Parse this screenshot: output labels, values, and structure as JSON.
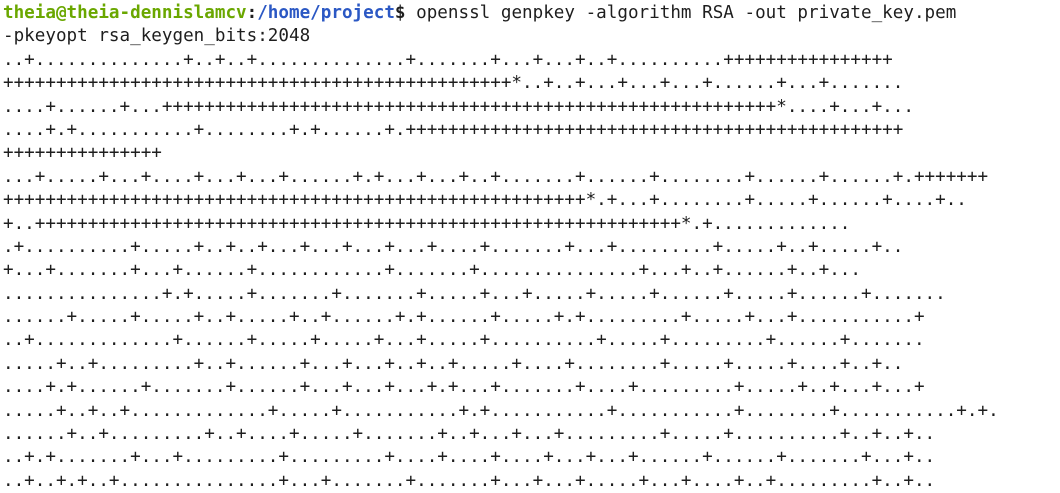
{
  "terminal": {
    "prompt": {
      "user_host": "theia@theia-dennislamcv",
      "separator": ":",
      "path": "/home/project",
      "symbol": "$"
    },
    "command": " openssl genpkey -algorithm RSA -out private_key.pem",
    "command_wrap": "-pkeyopt rsa_keygen_bits:2048",
    "output_lines": [
      "..+..............+..+..+..............+.......+...+...+..+..........++++++++++++++++",
      "++++++++++++++++++++++++++++++++++++++++++++++++*..+..+...+...+...+......+...+.......",
      "....+......+...++++++++++++++++++++++++++++++++++++++++++++++++++++++++++*....+...+...",
      "....+.+...........+........+.+......+.+++++++++++++++++++++++++++++++++++++++++++++++",
      "+++++++++++++++",
      "...+.....+...+....+...+...+......+.+...+...+..+.......+......+........+......+......+.+++++++",
      "+++++++++++++++++++++++++++++++++++++++++++++++++++++++*.+...+........+.....+......+....+..",
      "+..+++++++++++++++++++++++++++++++++++++++++++++++++++++++++++++*.+.............",
      ".+..........+.....+..+..+...+...+...+...+....+.......+...+.........+.....+..+.....+..",
      "+...+.......+...+......+............+.......+...............+...+..+......+..+...",
      "...............+.+.....+.......+.......+.....+...+.....+.....+......+.....+......+.......",
      "......+.....+.....+..+.....+..+......+.+......+.....+.+.........+.....+...+...........+",
      "..+.............+......+.....+.....+...+.....+..........+.....+.........+......+.......",
      ".....+..+.........+..+......+...+...+..+..+.....+....+........+.....+.....+....+..+..",
      "....+.+......+.......+......+...+...+...+.+...+.......+....+.........+.....+..+...+...+",
      ".....+..+..+.............+.....+...........+.+...........+...........+........+...........+.+.",
      "......+..+.........+..+....+.....+.......+..+...+...+.........+.....+..........+..+..+..",
      "..+.+.......+...+.........+.........+....+....+....+...+...+......+......+.......+...+..",
      "..+..+.+..+...............+...+.......+.......+...+...+.....+...+....+..+.........+..+.."
    ]
  }
}
